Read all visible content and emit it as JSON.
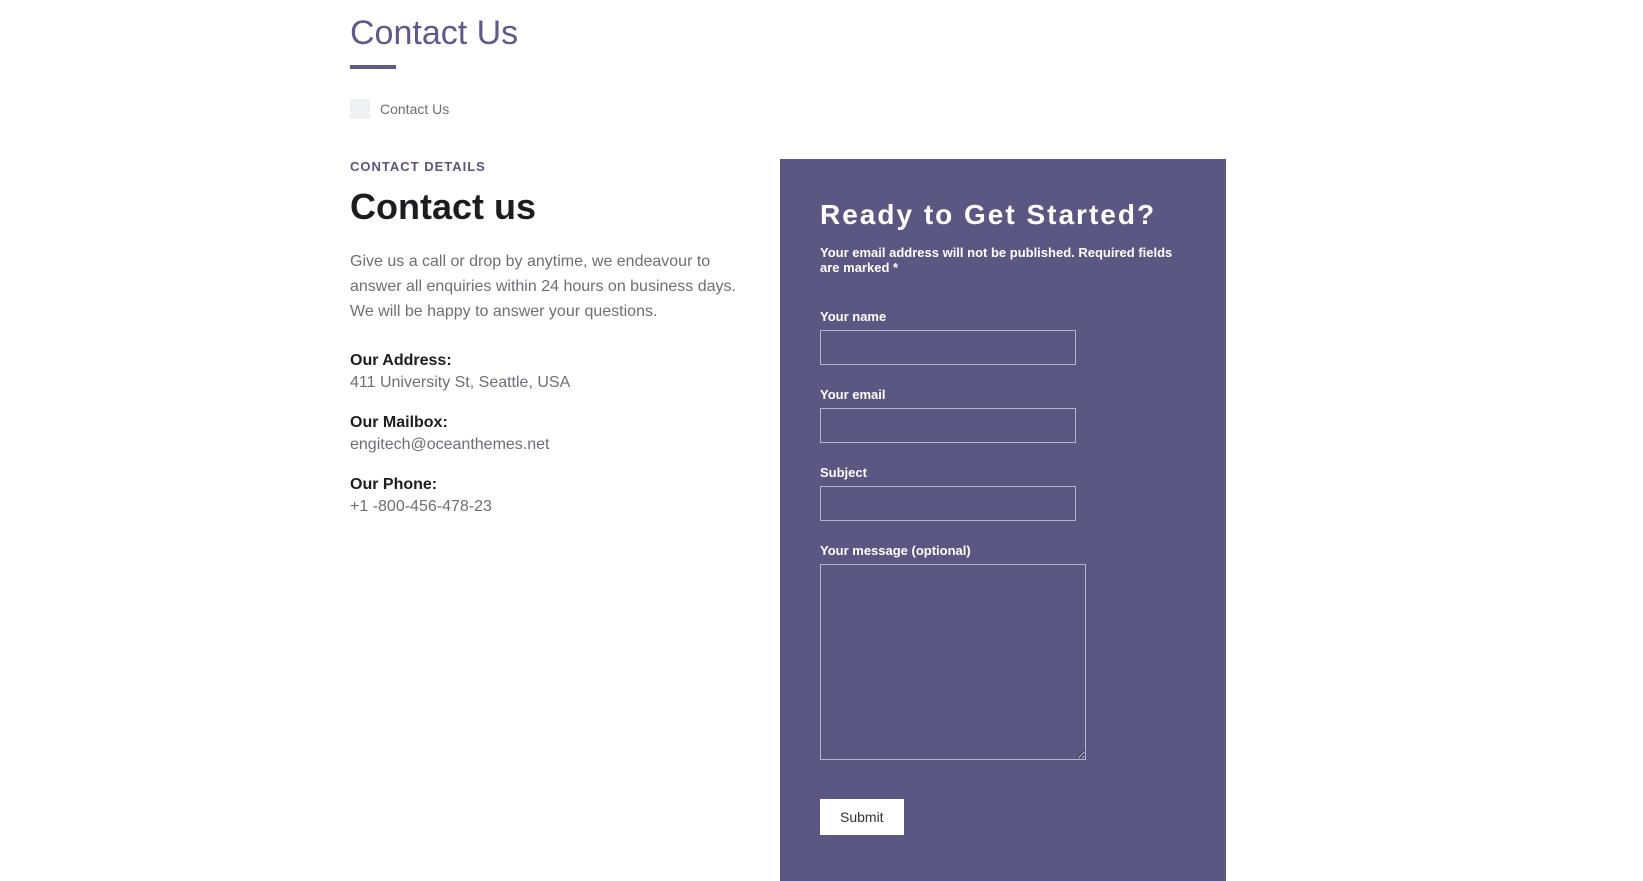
{
  "page": {
    "title": "Contact Us"
  },
  "breadcrumb": {
    "text": "Contact Us"
  },
  "details": {
    "subheading": "CONTACT DETAILS",
    "heading": "Contact us",
    "intro": "Give us a call or drop by anytime, we endeavour to answer all enquiries within 24 hours on business days. We will be happy to answer your questions.",
    "address_label": "Our Address:",
    "address_value": "411 University St, Seattle, USA",
    "mailbox_label": "Our Mailbox:",
    "mailbox_value": "engitech@oceanthemes.net",
    "phone_label": "Our Phone:",
    "phone_value": "+1 -800-456-478-23"
  },
  "form": {
    "title": "Ready to Get Started?",
    "note": "Your email address will not be published. Required fields are marked *",
    "name_label": "Your name",
    "email_label": "Your email",
    "subject_label": "Subject",
    "message_label": "Your message (optional)",
    "submit_label": "Submit"
  }
}
